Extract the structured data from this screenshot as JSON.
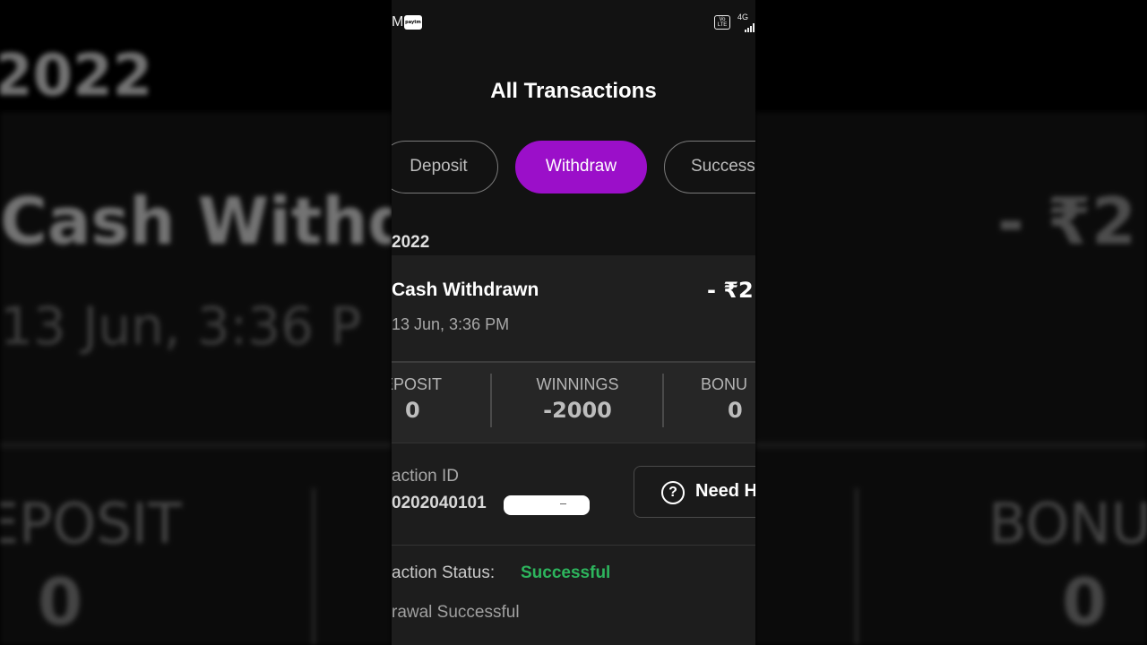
{
  "status_bar": {
    "left_text": "M",
    "paytm_badge": "paytm",
    "volte": "Vo LTE",
    "network": "4G"
  },
  "header": {
    "title": "All Transactions"
  },
  "tabs": [
    {
      "label": "Deposit",
      "active": false
    },
    {
      "label": "Withdraw",
      "active": true
    },
    {
      "label": "Success",
      "active": false
    }
  ],
  "section": {
    "year": "2022"
  },
  "transaction": {
    "title": "Cash Withdrawn",
    "amount": "- ₹2",
    "date": "13 Jun, 3:36 PM",
    "breakdown": [
      {
        "label": "EPOSIT",
        "value": "0"
      },
      {
        "label": "WINNINGS",
        "value": "-2000"
      },
      {
        "label": "BONU",
        "value": "0"
      }
    ],
    "id_label": "action ID",
    "id_value": "0202040101",
    "help_button": "Need H",
    "status_label": "action Status:",
    "status_value": "Successful",
    "status_message": "rawal Successful"
  },
  "background": {
    "year": "2022",
    "title": "Cash Withdr",
    "date": "13 Jun, 3:36 P",
    "amount": "- ₹2",
    "deposit_label": "EPOSIT",
    "deposit_value": "0",
    "bonus_label": "BONU",
    "bonus_value": "0"
  },
  "colors": {
    "accent": "#9b0fc9",
    "success": "#2db55d",
    "background": "#121212"
  }
}
